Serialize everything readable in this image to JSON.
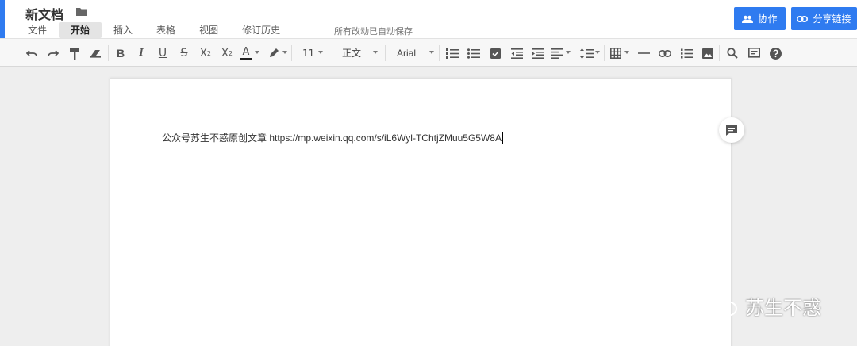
{
  "header": {
    "doc_title": "新文档",
    "menu": [
      {
        "label": "文件"
      },
      {
        "label": "开始"
      },
      {
        "label": "插入"
      },
      {
        "label": "表格"
      },
      {
        "label": "视图"
      },
      {
        "label": "修订历史"
      }
    ],
    "autosave": "所有改动已自动保存",
    "collab_label": "协作",
    "share_label": "分享链接",
    "accent_color": "#2f7bf0"
  },
  "toolbar": {
    "font_size": "11",
    "paragraph_style": "正文",
    "font_family": "Arial",
    "icons": [
      "undo-icon",
      "redo-icon",
      "format-painter-icon",
      "clear-format-icon",
      "bold-icon",
      "italic-icon",
      "underline-icon",
      "strikethrough-icon",
      "superscript-icon",
      "subscript-icon",
      "font-color-icon",
      "highlight-icon",
      "ordered-list-icon",
      "unordered-list-icon",
      "checkbox-icon",
      "outdent-icon",
      "indent-icon",
      "align-icon",
      "line-spacing-icon",
      "table-icon",
      "horizontal-rule-icon",
      "link-icon",
      "list-style-icon",
      "image-icon",
      "search-icon",
      "comment-panel-icon",
      "help-icon"
    ]
  },
  "document": {
    "text": "公众号苏生不惑原创文章 https://mp.weixin.qq.com/s/iL6Wyl-TChtjZMuu5G5W8A"
  },
  "watermark": {
    "text": "苏生不惑"
  }
}
